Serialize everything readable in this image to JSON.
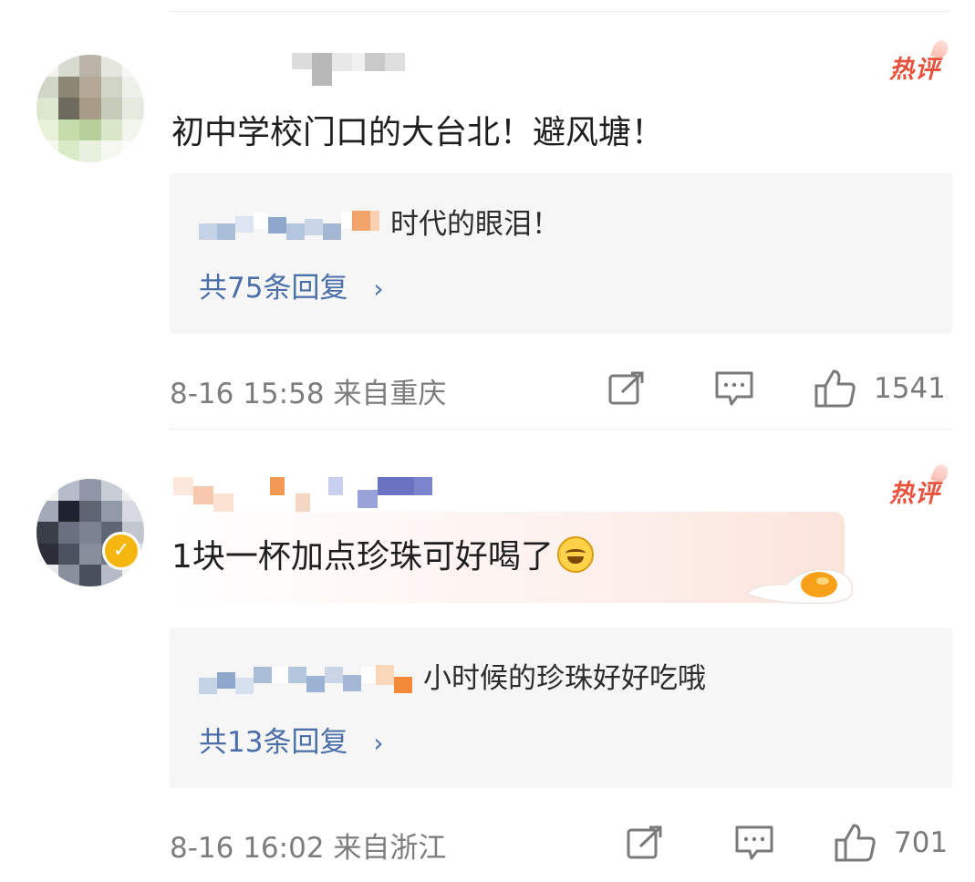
{
  "comments": [
    {
      "badge": "热评",
      "text": "初中学校门口的大台北！避风塘！",
      "reply": {
        "text": "时代的眼泪！",
        "count_label": "共75条回复",
        "chevron": "›"
      },
      "meta": "8-16 15:58  来自重庆",
      "likes": "1541",
      "icons": [
        "share-icon",
        "comment-icon",
        "like-icon"
      ]
    },
    {
      "badge": "热评",
      "text": "1块一杯加点珍珠可好喝了",
      "emoji": "laughing-emoji",
      "reply": {
        "text": "小时候的珍珠好好吃哦",
        "count_label": "共13条回复",
        "chevron": "›"
      },
      "meta": "8-16 16:02  来自浙江",
      "likes": "701",
      "icons": [
        "share-icon",
        "comment-icon",
        "like-icon"
      ]
    }
  ],
  "colors": {
    "hot_badge": "#e8513c",
    "reply_link": "#4b6fa8",
    "meta_text": "#7d7d7d",
    "reply_bg": "#f6f6f6",
    "verified": "#f5b70f"
  }
}
